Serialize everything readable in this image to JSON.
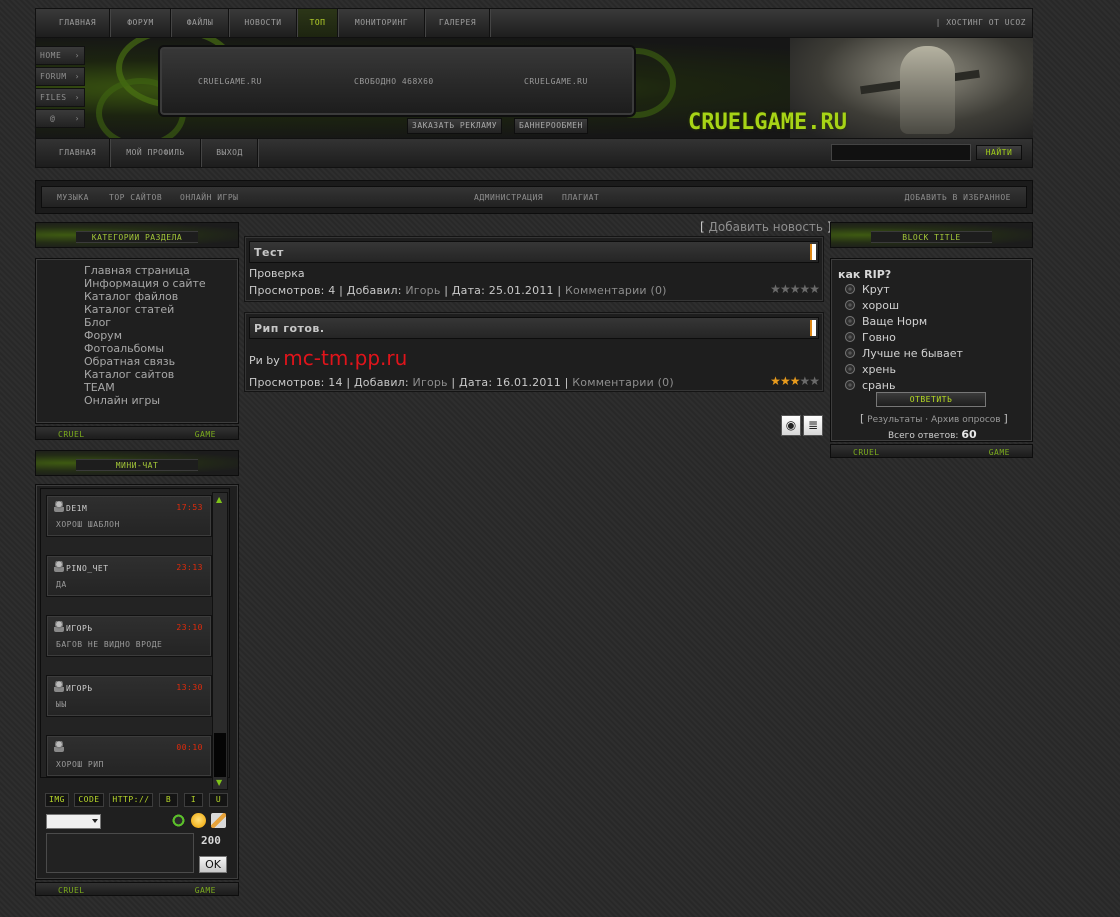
{
  "top_nav": {
    "items": [
      "Главная",
      "Форум",
      "Файлы",
      "Новости",
      "ТОП",
      "Мониторинг",
      "Галерея"
    ],
    "hosting": "| Хостинг от uCoz"
  },
  "side_icons": [
    "HOME",
    "FORUM",
    "FILES",
    "@"
  ],
  "banner": {
    "left": "CruelGame.Ru",
    "center": "Свободно 468x60",
    "right": "CruelGame.Ru",
    "order_ad": "Заказать рекламу",
    "exchange": "Баннерообмен"
  },
  "logo": "CRUELGAME.RU",
  "user_bar": {
    "items": [
      "Главная",
      "Мой профиль",
      "Выход"
    ],
    "search_button": "Найти",
    "search_value": ""
  },
  "bar2": {
    "left": [
      "Музыка",
      "ТОР сайтов",
      "Онлайн игры"
    ],
    "center": [
      "Администрация",
      "Плагиат"
    ],
    "right": "Добавить в избранное"
  },
  "categories": {
    "title": "Категории раздела",
    "items": [
      "Главная страница",
      "Информация о сайте",
      "Каталог файлов",
      "Каталог статей",
      "Блог",
      "Форум",
      "Фотоальбомы",
      "Обратная связь",
      "Каталог сайтов",
      "TEAM",
      "Онлайн игры"
    ],
    "foot_left": "CRUEL",
    "foot_right": "GAME"
  },
  "chat": {
    "title": "Мини-чат",
    "messages": [
      {
        "name": "DE1m",
        "time": "17:53",
        "text": "хорош шаблон"
      },
      {
        "name": "Pino_Чет",
        "time": "23:13",
        "text": "да"
      },
      {
        "name": "Игорь",
        "time": "23:10",
        "text": "багов не видно вроде"
      },
      {
        "name": "Игорь",
        "time": "13:30",
        "text": "ыы"
      },
      {
        "name": "",
        "time": "00:10",
        "text": "хорош рип"
      }
    ],
    "buttons": [
      "IMG",
      "CODE",
      "http://",
      "b",
      "i",
      "u"
    ],
    "counter": "200",
    "ok": "OK",
    "foot_left": "CRUEL",
    "foot_right": "GAME"
  },
  "content": {
    "add_news_open": "[",
    "add_news": "Добавить новость",
    "add_news_close": "]",
    "entries": [
      {
        "title": "Тест",
        "body": "Проверка",
        "views_label": "Просмотров:",
        "views": "4",
        "added_label": "Добавил:",
        "author": "Игорь",
        "date_label": "Дата:",
        "date": "25.01.2011",
        "comments": "Комментарии (0)",
        "rating": 0
      },
      {
        "title": "Рип готов.",
        "body_prefix": "Ри by",
        "body_link": "mc-tm.pp.ru",
        "views_label": "Просмотров:",
        "views": "14",
        "added_label": "Добавил:",
        "author": "Игорь",
        "date_label": "Дата:",
        "date": "16.01.2011",
        "comments": "Комментарии (0)",
        "rating": 3
      }
    ]
  },
  "poll": {
    "title": "Block title",
    "question": "как RIP?",
    "options": [
      "Крут",
      "хорош",
      "Ваще Норм",
      "Говно",
      "Лучше не бывает",
      "хрень",
      "срань"
    ],
    "vote": "Ответить",
    "results": "Результаты",
    "archive": "Архив опросов",
    "total_label": "Всего ответов:",
    "total": "60",
    "foot_left": "CRUEL",
    "foot_right": "GAME"
  },
  "colors": {
    "accent_green": "#a7d416",
    "time_red": "#e02b0c",
    "star_on": "#e89b1d",
    "link_red": "#e0141b"
  }
}
